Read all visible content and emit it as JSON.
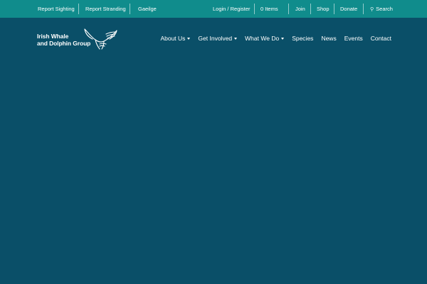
{
  "colors": {
    "topbar_bg": "#108c8c",
    "page_bg": "#0a4f68",
    "text": "#ffffff"
  },
  "topbar": {
    "report_sighting": "Report Sighting",
    "report_stranding": "Report Stranding",
    "gaeilge": "Gaeilge",
    "login_register": "Login / Register",
    "cart_items": "0 Items",
    "join": "Join",
    "shop": "Shop",
    "donate": "Donate",
    "search": "Search"
  },
  "logo": {
    "line1": "Irish Whale",
    "line2": "and Dolphin Group",
    "icon": "whale-tail-icon"
  },
  "nav": {
    "items": [
      {
        "label": "About Us",
        "has_dropdown": true
      },
      {
        "label": "Get Involved",
        "has_dropdown": true
      },
      {
        "label": "What We Do",
        "has_dropdown": true
      },
      {
        "label": "Species",
        "has_dropdown": false
      },
      {
        "label": "News",
        "has_dropdown": false
      },
      {
        "label": "Events",
        "has_dropdown": false
      },
      {
        "label": "Contact",
        "has_dropdown": false
      }
    ]
  }
}
